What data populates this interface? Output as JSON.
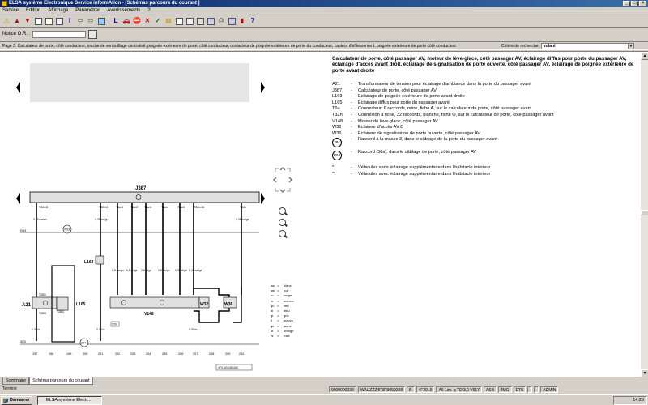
{
  "window": {
    "title": "ELSA système Electronique Service informAtion - [Schémas parcours du courant ]",
    "controls": [
      "_",
      "□",
      "×"
    ]
  },
  "menu": {
    "items": [
      "Service",
      "Edition",
      "Affichage",
      "Paramétrer",
      "Avertissements",
      "?"
    ]
  },
  "notice": {
    "label": "Notice O.R. :"
  },
  "page": {
    "info": "Page 3: Calculateur de porte, côté conducteur, touche de verrouillage centralisé, poignée extérieure de porte, côté conducteur, contacteur de poignée extérieure de porte du conducteur, capteur d'effleurement, poignée extérieure de porte côté conducteur",
    "search_label": "Critère de recherche",
    "search_value": "volant"
  },
  "legend": {
    "title": "Calculateur de porte, côté passager AV, moteur de lève-glace, côté passager AV, éclairage diffus pour porte du passager AV, éclairage d'accès avant droit, éclairage de signalisation de porte ouverte, côté passager AV, éclairage de poignée extérieure de porte avant droite",
    "items": [
      {
        "code": "A21",
        "desc": "Transformateur de tension pour éclairage d'ambiance dans la porte du passager avant"
      },
      {
        "code": "J387",
        "desc": "Calculateur de porte, côté passager AV"
      },
      {
        "code": "L163",
        "desc": "Eclairage de poignée extérieure de porte avant droite"
      },
      {
        "code": "L165",
        "desc": "Eclairage diffus pour porte du passager avant"
      },
      {
        "code": "T6u",
        "desc": "Connecteur, 6 raccords, noire, fiche A, sur le calculateur de porte, côté passager avant"
      },
      {
        "code": "T32h",
        "desc": "Connexion à fiche, 32 raccords, blanche, fiche O, sur le calculateur de porte, côté passager avant"
      },
      {
        "code": "V148",
        "desc": "Moteur de lève-glace, côté passager AV"
      },
      {
        "code": "W32",
        "desc": "Eclaireur d'accès AV D"
      },
      {
        "code": "W36",
        "desc": "Eclaireur de signalisation de porte ouverte, côté passager AV"
      }
    ],
    "circle_items": [
      {
        "code": "384",
        "desc": "Raccord à la masse 3, dans le câblage de la porte du passager avant"
      },
      {
        "code": "R53",
        "desc": "Raccord (58s), dans le câblage de porte, côté passager AV"
      }
    ],
    "notes": [
      {
        "code": "*",
        "desc": "Véhicules sans éclairage supplémentaire dans l'habitacle intérieur"
      },
      {
        "code": "**",
        "desc": "Véhicules avec éclairage supplémentaire dans l'habitacle intérieur"
      }
    ]
  },
  "diagram": {
    "module_label": "J387",
    "pins": [
      "T32h/8",
      "T32h/3",
      "T6u/1",
      "T6u/2",
      "T6u/4",
      "T6u/3",
      "T6u/5",
      "T32h/16",
      "T32h"
    ],
    "rails": {
      "top": "R53",
      "bottom": "303"
    },
    "components": [
      "A21",
      "L163",
      "L165",
      "V148",
      "W32",
      "W36"
    ],
    "bottom_numbers": [
      "197",
      "198",
      "199",
      "200",
      "201",
      "202",
      "203",
      "204",
      "205",
      "206",
      "207",
      "208",
      "209",
      "210"
    ],
    "wire_labels": [
      "0,35 sw/ws",
      "0,35 ws/gr",
      "0,5 sw/gn",
      "0,5 gr/ge",
      "2,5 bl/gn",
      "2,5 ws/gn",
      "0,35 bl/ge",
      "0,35 ws/ge",
      "0,35 br",
      "0,35 ws/ge",
      "0,35 br",
      "0,35 br"
    ],
    "inline_labels": [
      "T28/3",
      "T28/1",
      "T28/2",
      "226",
      "384"
    ],
    "reference": "4F0-104180406",
    "color_codes": [
      {
        "code": "ws",
        "name": "blanc"
      },
      {
        "code": "sw",
        "name": "noir"
      },
      {
        "code": "ro",
        "name": "rouge"
      },
      {
        "code": "br",
        "name": "marron"
      },
      {
        "code": "gn",
        "name": "vert"
      },
      {
        "code": "bl",
        "name": "bleu"
      },
      {
        "code": "gr",
        "name": "gris"
      },
      {
        "code": "li",
        "name": "mauve"
      },
      {
        "code": "ge",
        "name": "jaune"
      },
      {
        "code": "or",
        "name": "orange"
      },
      {
        "code": "rs",
        "name": "rose"
      }
    ]
  },
  "tabs": [
    "Sommaire",
    "Schéma parcours du courant"
  ],
  "status": {
    "left": "Terminé",
    "cells": [
      "9000000038",
      "WAUZZZ4F3R9059328",
      "B",
      "4F20L9",
      "A6 Lim. q TDI3,0 V617",
      "ASB",
      "JMG",
      "ETS",
      "",
      "",
      "ADMIN"
    ]
  },
  "taskbar": {
    "start": "Démarrer",
    "task": "ELSA système Electr...",
    "clock": "14:29"
  }
}
